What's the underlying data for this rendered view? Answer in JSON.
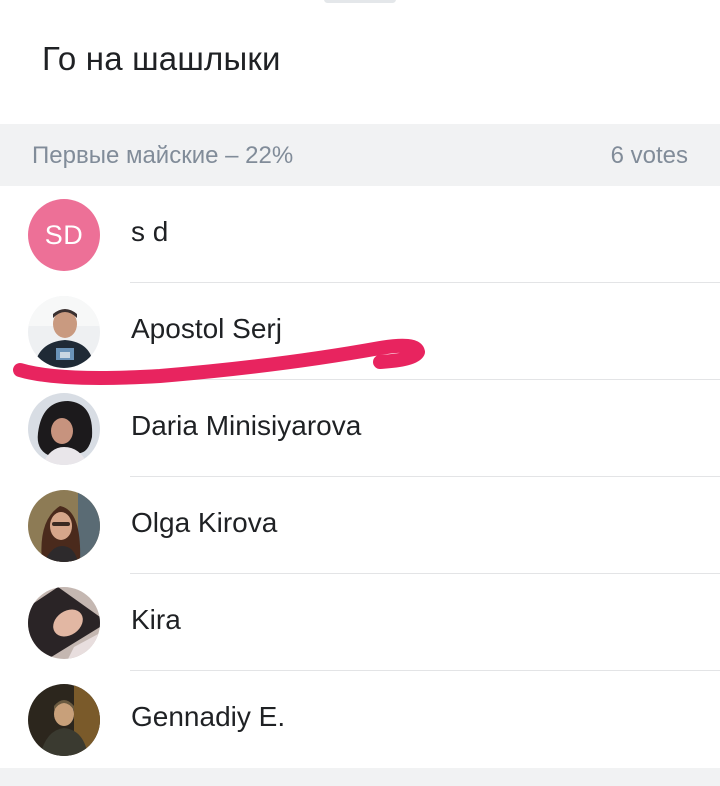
{
  "poll": {
    "title": "Го на шашлыки"
  },
  "option": {
    "label": "Первые майские – 22%",
    "percent": 22,
    "votes_label": "6 votes"
  },
  "voters": [
    {
      "name": "s d",
      "avatar_initials": "SD",
      "avatar_color": "#ed7097",
      "avatar_icon": "initials"
    },
    {
      "name": "Apostol Serj",
      "avatar_icon": "user-photo"
    },
    {
      "name": "Daria Minisiyarova",
      "avatar_icon": "user-photo"
    },
    {
      "name": "Olga Kirova",
      "avatar_icon": "user-photo"
    },
    {
      "name": "Kira",
      "avatar_icon": "user-photo"
    },
    {
      "name": "Gennadiy E.",
      "avatar_icon": "user-photo"
    }
  ],
  "annotation": {
    "color": "#e8245f",
    "kind": "hand-drawn underline"
  }
}
